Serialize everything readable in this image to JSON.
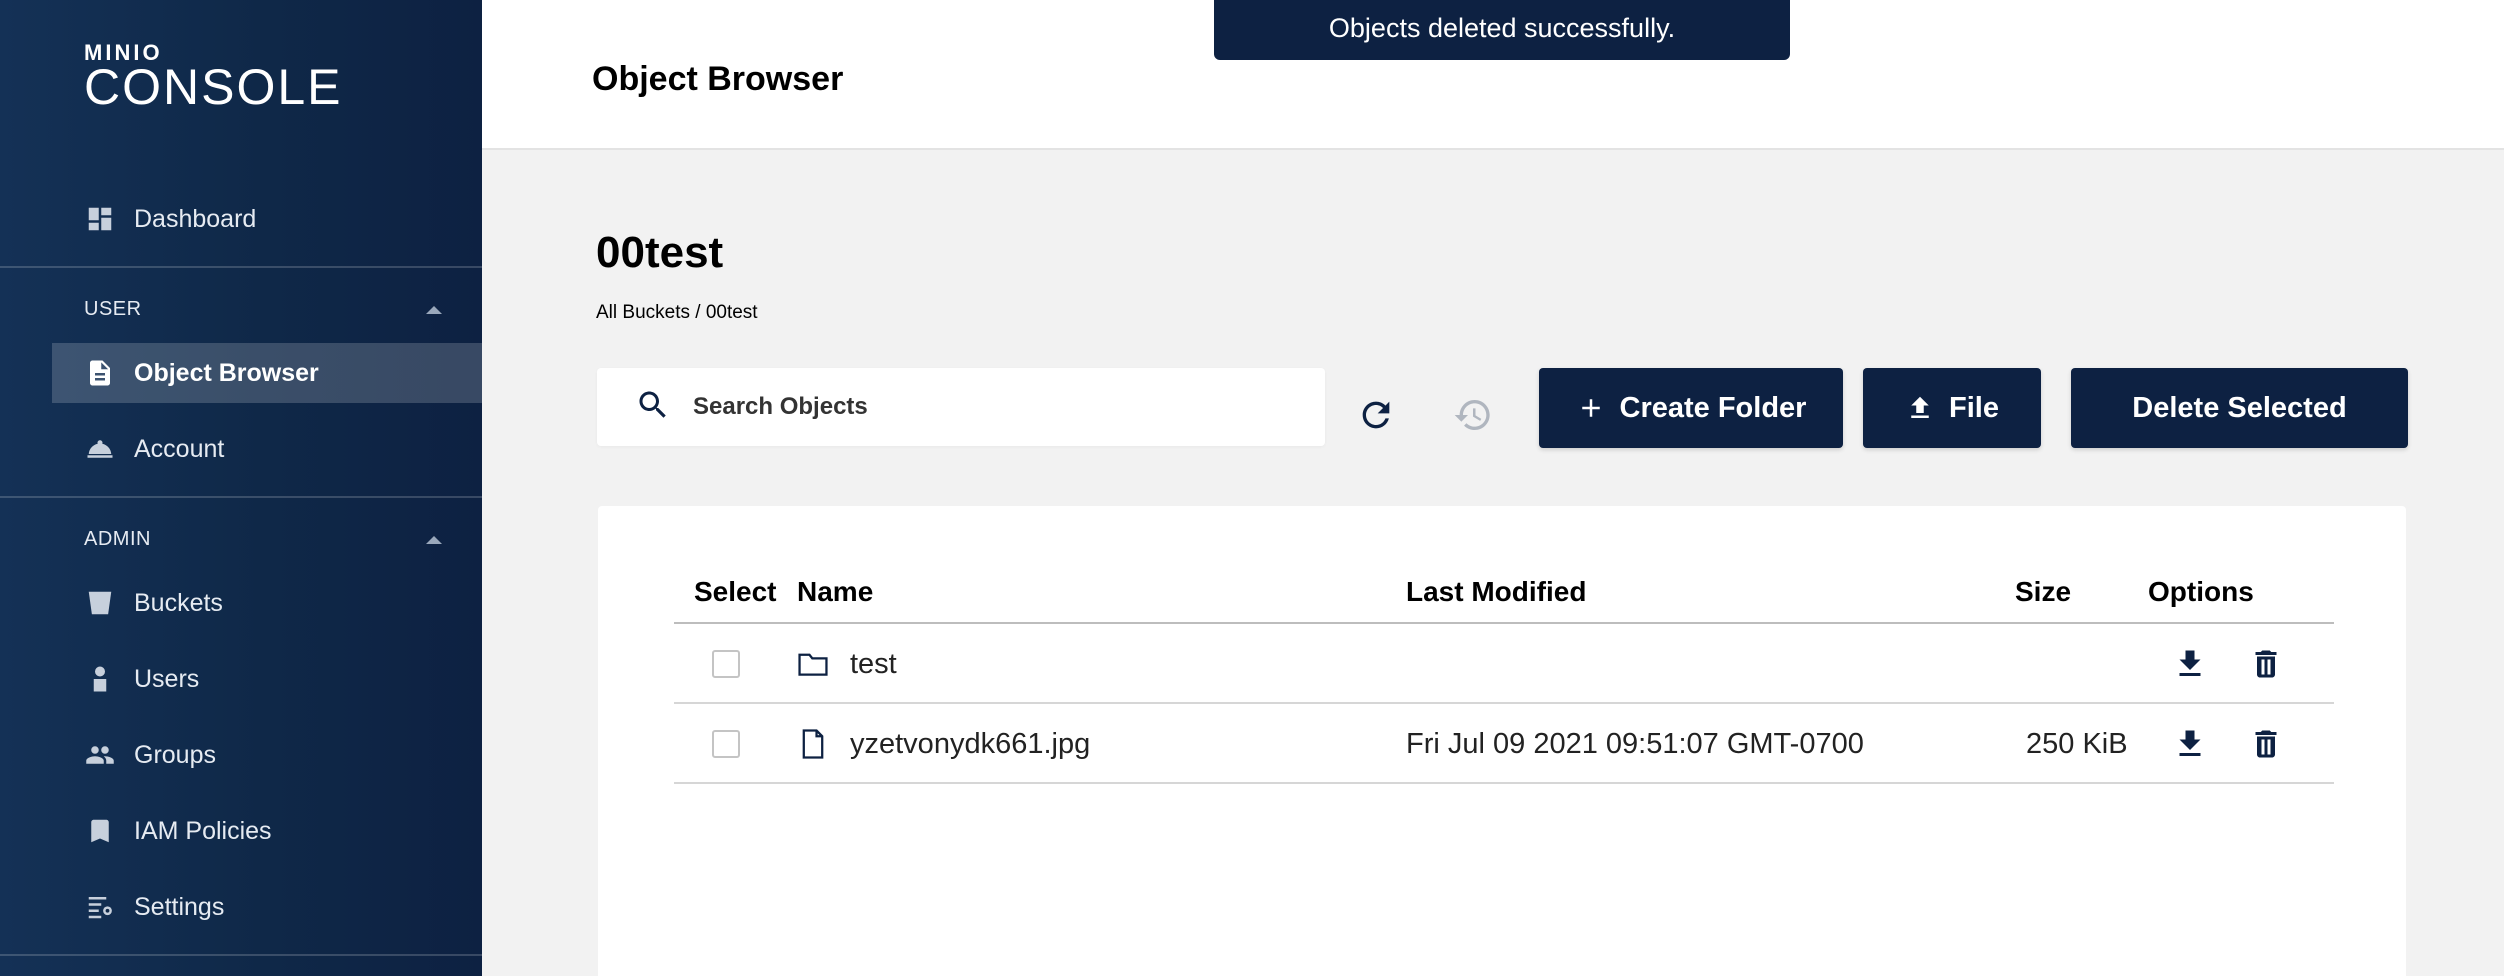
{
  "app": {
    "logo_top": "MINIO",
    "logo_bottom": "CONSOLE"
  },
  "sidebar": {
    "dashboard": "Dashboard",
    "user_section": "USER",
    "object_browser": "Object Browser",
    "account": "Account",
    "admin_section": "ADMIN",
    "buckets": "Buckets",
    "users": "Users",
    "groups": "Groups",
    "iam_policies": "IAM Policies",
    "settings": "Settings"
  },
  "header": {
    "title": "Object Browser",
    "toast": "Objects deleted successfully."
  },
  "bucket": {
    "name": "00test",
    "breadcrumb": "All Buckets / 00test"
  },
  "search": {
    "placeholder": "Search Objects",
    "value": ""
  },
  "toolbar": {
    "create_folder": "Create Folder",
    "file": "File",
    "delete_selected": "Delete Selected"
  },
  "table": {
    "columns": {
      "select": "Select",
      "name": "Name",
      "last_modified": "Last Modified",
      "size": "Size",
      "options": "Options"
    },
    "rows": [
      {
        "type": "folder",
        "name": "test",
        "last_modified": "",
        "size": ""
      },
      {
        "type": "file",
        "name": "yzetvonydk661.jpg",
        "last_modified": "Fri Jul 09 2021 09:51:07 GMT-0700",
        "size": "250 KiB"
      }
    ]
  },
  "colors": {
    "navy": "#0d2142",
    "sidebar": "#143156",
    "background": "#f2f2f2"
  }
}
